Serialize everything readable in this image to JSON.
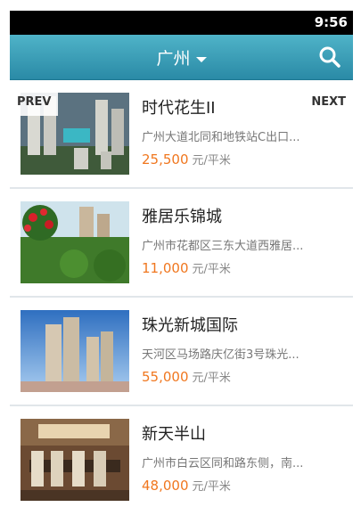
{
  "status": {
    "time": "9:56"
  },
  "header": {
    "city": "广州",
    "search_icon": "search-icon",
    "dropdown_icon": "chevron-down-icon"
  },
  "nav": {
    "prev": "PREV",
    "next": "NEXT"
  },
  "colors": {
    "header_top": "#4fb3c8",
    "header_bottom": "#2a8aa6",
    "price": "#f0771f"
  },
  "listings": [
    {
      "name": "时代花生II",
      "address": "广州大道北同和地铁站C出口...",
      "price": "25,500",
      "unit": "元/平米",
      "image": "aerial-view-of-residential-towers"
    },
    {
      "name": "雅居乐锦城",
      "address": "广州市花都区三东大道西雅居...",
      "price": "11,000",
      "unit": "元/平米",
      "image": "garden-with-red-flowers-and-towers"
    },
    {
      "name": "珠光新城国际",
      "address": "天河区马场路庆亿街3号珠光...",
      "price": "55,000",
      "unit": "元/平米",
      "image": "high-rise-towers-under-blue-sky"
    },
    {
      "name": "新天半山",
      "address": "广州市白云区同和路东侧，南...",
      "price": "48,000",
      "unit": "元/平米",
      "image": "dining-room-interior"
    }
  ]
}
